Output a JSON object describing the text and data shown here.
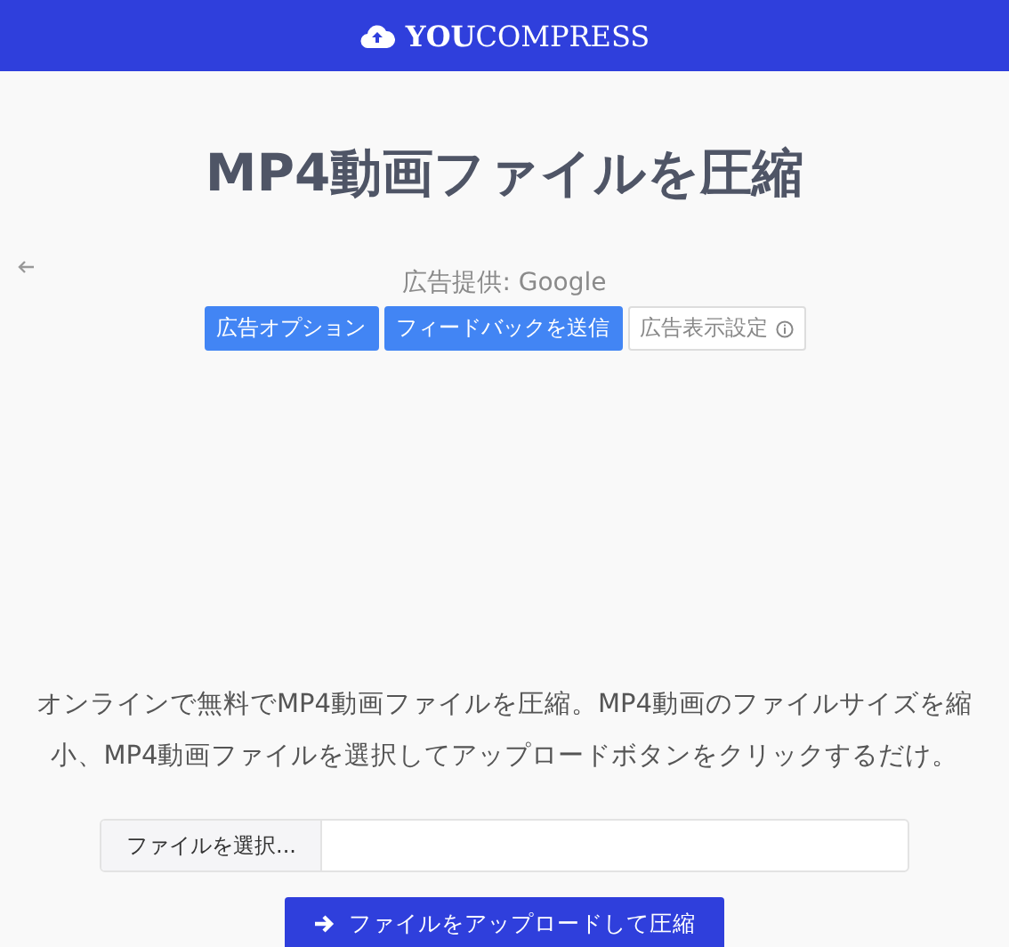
{
  "header": {
    "logo": "**YOU**COMPRESS"
  },
  "title": "MP4動画ファイルを圧縮",
  "ad": {
    "provider": "広告提供: Google",
    "buttons": [
      {
        "label": "広告オプション",
        "kind": "primary"
      },
      {
        "label": "フィードバックを送信",
        "kind": "primary"
      },
      {
        "label": "広告表示設定",
        "kind": "info"
      }
    ]
  },
  "description": "オンラインで無料でMP4動画ファイルを圧縮。MP4動画のファイルサイズを縮小、MP4動画ファイルを選択してアップロードボタンをクリックするだけ。",
  "file_input": {
    "button": "ファイルを選択..."
  },
  "upload_button": "ファイルをアップロードして圧縮"
}
